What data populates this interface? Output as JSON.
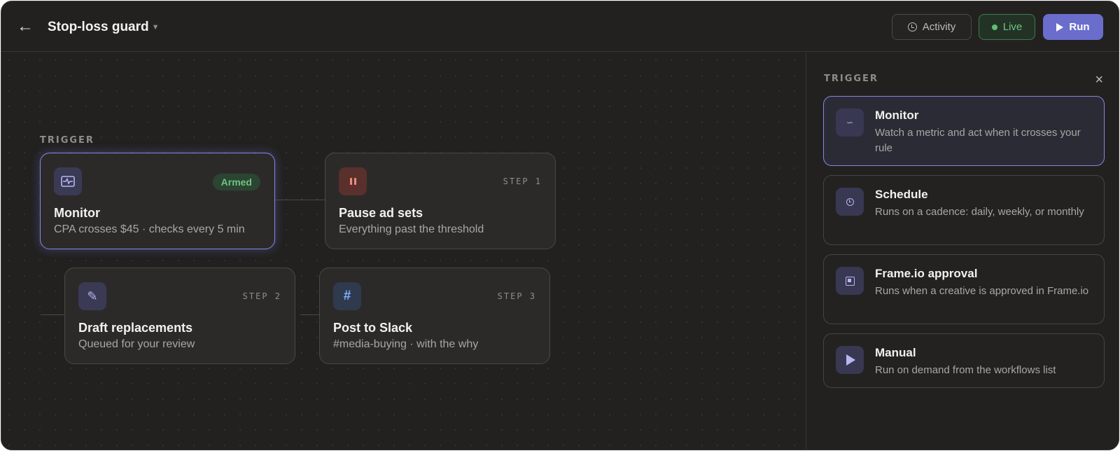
{
  "header": {
    "back_icon": "arrow-left-icon",
    "title": "Stop-loss guard",
    "activity_label": "Activity",
    "live_label": "Live",
    "run_label": "Run"
  },
  "canvas": {
    "section_label": "TRIGGER",
    "nodes": [
      {
        "icon": "pulse-icon",
        "badge": "Armed",
        "title": "Monitor",
        "subtitle": "CPA crosses $45 · checks every 5 min"
      },
      {
        "icon": "pause-icon",
        "step": "STEP 1",
        "title": "Pause ad sets",
        "subtitle": "Everything past the threshold"
      },
      {
        "icon": "pencil-icon",
        "step": "STEP 2",
        "title": "Draft replacements",
        "subtitle": "Queued for your review"
      },
      {
        "icon": "hash-icon",
        "step": "STEP 3",
        "title": "Post to Slack",
        "subtitle": "#media-buying · with the why"
      }
    ]
  },
  "panel": {
    "section_label": "TRIGGER",
    "close_icon": "close-icon",
    "options": [
      {
        "icon": "wave-icon",
        "title": "Monitor",
        "description": "Watch a metric and act when it crosses your rule",
        "selected": true
      },
      {
        "icon": "clock-icon",
        "title": "Schedule",
        "description": "Runs on a cadence: daily, weekly, or monthly",
        "selected": false
      },
      {
        "icon": "frame-icon",
        "title": "Frame.io approval",
        "description": "Runs when a creative is approved in Frame.io",
        "selected": false
      },
      {
        "icon": "play-icon",
        "title": "Manual",
        "description": "Run on demand from the workflows list",
        "selected": false
      }
    ]
  },
  "colors": {
    "accent": "#6b6dcc",
    "live_green": "#6ec482",
    "background": "#222120"
  }
}
